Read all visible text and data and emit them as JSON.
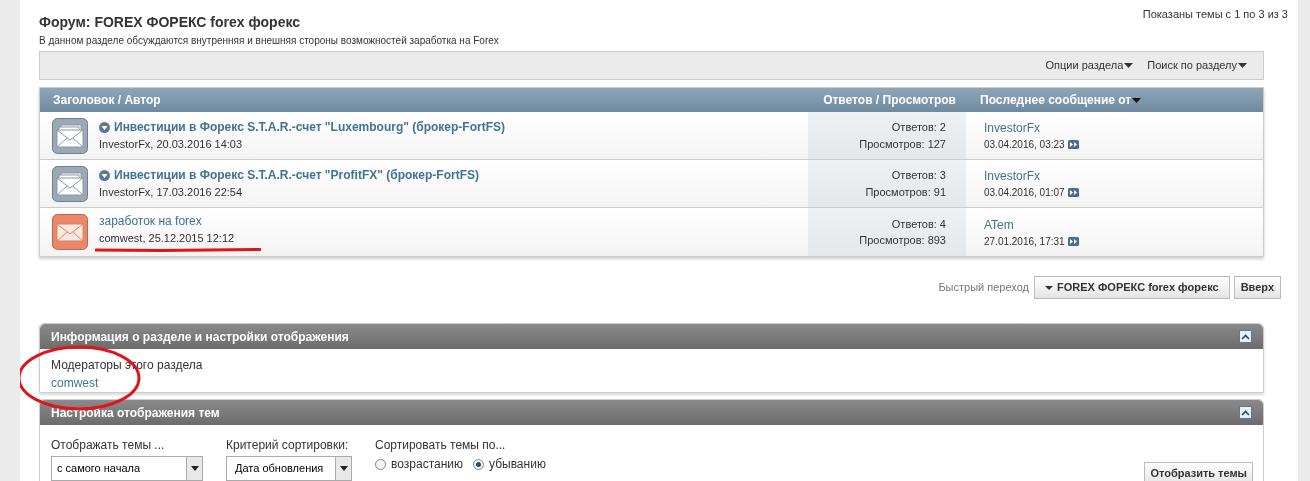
{
  "forum": {
    "title": "Форум: FOREX ФОРЕКС forex форекс",
    "description": "В данном разделе обсуждаются внутренняя и внешняя стороны возможностей заработка на Forex",
    "pagination": "Показаны темы с 1 по 3 из 3"
  },
  "toolbar": [
    "Опции раздела",
    "Поиск по разделу"
  ],
  "table": {
    "columns": [
      "Заголовок / Автор",
      "Ответов / Просмотров",
      "Последнее сообщение от"
    ],
    "rows": [
      {
        "kind": "old",
        "title": "Инвестиции в Форекс S.T.A.R.-счет \"Luxembourg\" (брокер-FortFS)",
        "author": "InvestorFx, 20.03.2016 14:03",
        "replies": "Ответов: 2",
        "views": "Просмотров: 127",
        "last_user": "InvestorFx",
        "last_date": "03.04.2016, 03:23",
        "underlined": false
      },
      {
        "kind": "old",
        "title": "Инвестиции в Форекс S.T.A.R.-счет \"ProfitFX\" (брокер-FortFS)",
        "author": "InvestorFx, 17.03.2016 22:54",
        "replies": "Ответов: 3",
        "views": "Просмотров: 91",
        "last_user": "InvestorFx",
        "last_date": "03.04.2016, 01:07",
        "underlined": false
      },
      {
        "kind": "new",
        "title": "заработок на forex",
        "author": "comwest, 25.12.2015 12:12",
        "replies": "Ответов: 4",
        "views": "Просмотров: 893",
        "last_user": "ATem",
        "last_date": "27.01.2016, 17:31",
        "underlined": true
      }
    ]
  },
  "quick_nav": {
    "label": "Быстрый переход",
    "forum_button": "FOREX ФОРЕКС forex форекс",
    "top_button": "Вверх"
  },
  "info_panel": {
    "title": "Информация о разделе и настройки отображения",
    "moderators_label": "Модераторы этого раздела",
    "moderator": "comwest",
    "circled": true
  },
  "display_panel": {
    "title": "Настройка отображения тем",
    "show_label": "Отображать темы ...",
    "show_value": "с самого начала",
    "sort_label": "Критерий сортировки:",
    "sort_value": "Дата обновления",
    "order_label": "Сортировать темы по...",
    "order_options": [
      {
        "label": "возрастанию",
        "selected": false
      },
      {
        "label": "убыванию",
        "selected": true
      }
    ],
    "submit": "Отобразить темы"
  }
}
